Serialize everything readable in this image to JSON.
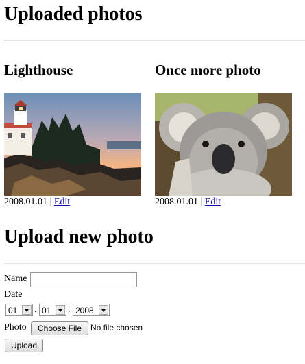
{
  "page": {
    "heading": "Uploaded photos",
    "upload_heading": "Upload new photo"
  },
  "photos": [
    {
      "title": "Lighthouse",
      "date": "2008.01.01",
      "separator": "|",
      "edit_label": "Edit",
      "image": "lighthouse-photo"
    },
    {
      "title": "Once more photo",
      "date": "2008.01.01",
      "separator": "|",
      "edit_label": "Edit",
      "image": "koala-photo"
    }
  ],
  "form": {
    "name_label": "Name",
    "name_value": "",
    "date_label": "Date",
    "day_value": "01",
    "month_value": "01",
    "year_value": "2008",
    "date_separator": ".",
    "photo_label": "Photo",
    "choose_file_label": "Choose File",
    "no_file_text": "No file chosen",
    "upload_label": "Upload"
  },
  "colors": {
    "link": "#1a0dab",
    "rule": "#a0a0a0"
  }
}
